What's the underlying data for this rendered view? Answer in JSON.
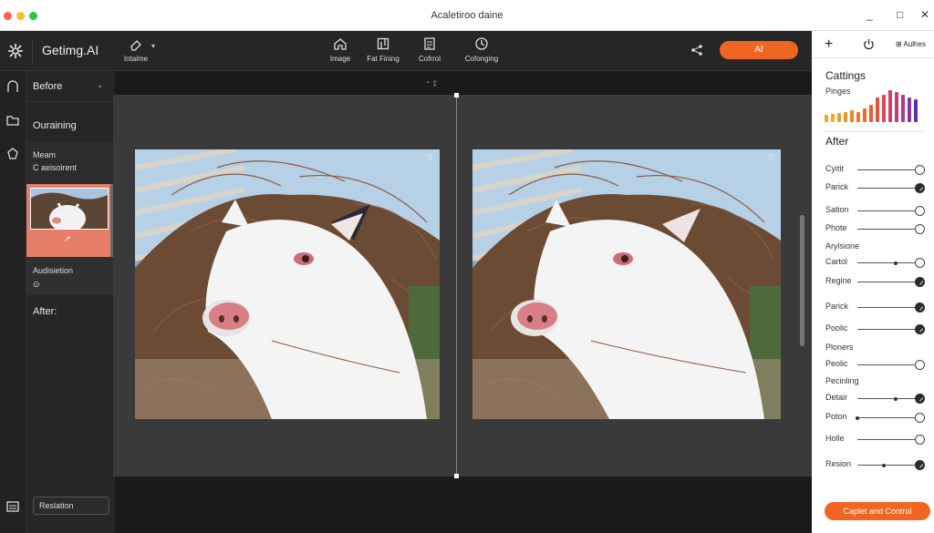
{
  "window": {
    "title": "Acaletiroo daine",
    "minimize": "_",
    "maximize": "□",
    "close": "✕"
  },
  "app": {
    "name": "Getimg.AI"
  },
  "toolbar": {
    "tools": [
      {
        "label": "Intaime",
        "icon": "eraser-icon"
      },
      {
        "label": "Image",
        "icon": "home-icon"
      },
      {
        "label": "Fat Fining",
        "icon": "crop-icon"
      },
      {
        "label": "Cofrrol",
        "icon": "document-icon"
      },
      {
        "label": "Cofonging",
        "icon": "timer-icon"
      }
    ],
    "ai_button": "AI"
  },
  "left_panel": {
    "header": "Before",
    "section_1": "Ouraining",
    "item_title": "Meam",
    "item_sub": "C aeisoirent",
    "adjust_title": "Audisietion",
    "adjust_icon": "⊙",
    "after_label": "After:",
    "bottom_button": "Reslation",
    "bottom_chevron": "›",
    "thumb_edit": "↗"
  },
  "canvas": {
    "top_indicator": "⌃ ⁑"
  },
  "right_panel": {
    "adjust_label": "Aulhes",
    "settings_title": "Cattings",
    "histogram_label": "Pinges",
    "histogram_values": [
      0.2,
      0.24,
      0.26,
      0.3,
      0.34,
      0.3,
      0.4,
      0.5,
      0.7,
      0.8,
      0.92,
      0.86,
      0.8,
      0.72,
      0.65
    ],
    "histogram_colors": [
      "#f5a623",
      "#f5a623",
      "#f39b24",
      "#f39025",
      "#f28427",
      "#f07828",
      "#ef6a2a",
      "#ee5c30",
      "#ec4f3e",
      "#e5454f",
      "#d93d63",
      "#c63a78",
      "#b03a8c",
      "#8e34a0",
      "#5b2bb0"
    ],
    "after_title": "After",
    "sliders": [
      {
        "label": "Cyitit",
        "value": 1.0,
        "knob": "open"
      },
      {
        "label": "Parick",
        "value": 1.0,
        "knob": "fill"
      },
      {
        "label": "Sation",
        "value": 1.0,
        "knob": "open"
      },
      {
        "label": "Phote",
        "value": 1.0,
        "knob": "open"
      },
      {
        "group": "Arylsione"
      },
      {
        "label": "Cartol",
        "value": 1.0,
        "knob": "open",
        "marker": 0.65
      },
      {
        "label": "Regine",
        "value": 1.0,
        "knob": "fill"
      },
      {
        "label": "Parick",
        "value": 1.0,
        "knob": "fill"
      },
      {
        "label": "Poolic",
        "value": 1.0,
        "knob": "fill"
      },
      {
        "group": "Ploners"
      },
      {
        "label": "Peolic",
        "value": 1.0,
        "knob": "open"
      },
      {
        "group": "Pecinling"
      },
      {
        "label": "Detair",
        "value": 1.0,
        "knob": "fill",
        "marker": 0.65
      },
      {
        "label": "Poton",
        "value": 1.0,
        "knob": "open",
        "marker": 0.0
      },
      {
        "label": "Holle",
        "value": 1.0,
        "knob": "open"
      },
      {
        "label": "Resion",
        "value": 1.0,
        "knob": "fill",
        "marker": 0.45
      }
    ],
    "cta": "Caplet and Control"
  }
}
